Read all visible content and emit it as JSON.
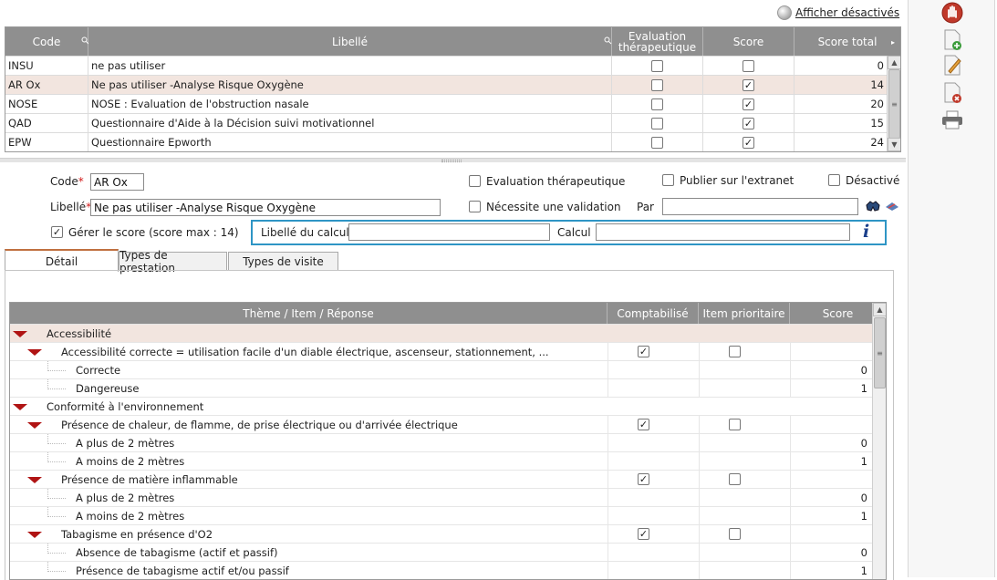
{
  "top": {
    "show_disabled_label": "Afficher désactivés"
  },
  "grid1": {
    "columns": [
      "Code",
      "Libellé",
      "Evaluation thérapeutique",
      "Score",
      "Score total"
    ],
    "rows": [
      {
        "code": "INSU",
        "libelle": "ne pas utiliser",
        "eval": false,
        "score": false,
        "total": "0",
        "selected": false
      },
      {
        "code": "AR Ox",
        "libelle": "Ne pas utiliser -Analyse Risque Oxygène",
        "eval": false,
        "score": true,
        "total": "14",
        "selected": true
      },
      {
        "code": "NOSE",
        "libelle": "NOSE : Evaluation de l'obstruction nasale",
        "eval": false,
        "score": true,
        "total": "20",
        "selected": false
      },
      {
        "code": "QAD",
        "libelle": "Questionnaire d'Aide à la Décision suivi motivationnel",
        "eval": false,
        "score": true,
        "total": "15",
        "selected": false
      },
      {
        "code": "EPW",
        "libelle": "Questionnaire Epworth",
        "eval": false,
        "score": true,
        "total": "24",
        "selected": false
      }
    ]
  },
  "form": {
    "code_label": "Code",
    "code_value": "AR Ox",
    "libelle_label": "Libellé",
    "libelle_value": "Ne pas utiliser -Analyse Risque Oxygène",
    "eval_label": "Evaluation thérapeutique",
    "eval_checked": false,
    "publish_label": "Publier sur l'extranet",
    "publish_checked": false,
    "disabled_label": "Désactivé",
    "disabled_checked": false,
    "validation_label": "Nécessite une validation",
    "validation_checked": false,
    "par_label": "Par",
    "par_value": "",
    "score_label": "Gérer le score (score max : 14)",
    "score_checked": true,
    "calc_label_label": "Libellé du calcul",
    "calc_label_value": "",
    "calc_label": "Calcul",
    "calc_value": ""
  },
  "tabs": [
    "Détail",
    "Types de prestation",
    "Types de visite"
  ],
  "grid2": {
    "columns": [
      "Thème / Item / Réponse",
      "Comptabilisé",
      "Item prioritaire",
      "Score"
    ],
    "rows": [
      {
        "level": 0,
        "label": "Accessibilité",
        "expand": true,
        "comp": null,
        "prio": null,
        "score": "",
        "selected": true
      },
      {
        "level": 1,
        "label": "Accessibilité correcte = utilisation facile d'un diable électrique, ascenseur, stationnement, ...",
        "expand": true,
        "comp": true,
        "prio": false,
        "score": ""
      },
      {
        "level": 2,
        "label": "Correcte",
        "expand": false,
        "comp": null,
        "prio": null,
        "score": "0"
      },
      {
        "level": 2,
        "label": "Dangereuse",
        "expand": false,
        "comp": null,
        "prio": null,
        "score": "1"
      },
      {
        "level": 0,
        "label": "Conformité à l'environnement",
        "expand": true,
        "comp": null,
        "prio": null,
        "score": ""
      },
      {
        "level": 1,
        "label": "Présence de chaleur, de flamme, de prise électrique ou d'arrivée électrique",
        "expand": true,
        "comp": true,
        "prio": false,
        "score": ""
      },
      {
        "level": 2,
        "label": "A plus de 2 mètres",
        "expand": false,
        "comp": null,
        "prio": null,
        "score": "0"
      },
      {
        "level": 2,
        "label": "A moins de 2 mètres",
        "expand": false,
        "comp": null,
        "prio": null,
        "score": "1"
      },
      {
        "level": 1,
        "label": "Présence de matière inflammable",
        "expand": true,
        "comp": true,
        "prio": false,
        "score": ""
      },
      {
        "level": 2,
        "label": "A plus de 2 mètres",
        "expand": false,
        "comp": null,
        "prio": null,
        "score": "0"
      },
      {
        "level": 2,
        "label": "A moins de 2 mètres",
        "expand": false,
        "comp": null,
        "prio": null,
        "score": "1"
      },
      {
        "level": 1,
        "label": "Tabagisme en présence d'O2",
        "expand": true,
        "comp": true,
        "prio": false,
        "score": ""
      },
      {
        "level": 2,
        "label": "Absence de tabagisme (actif et passif)",
        "expand": false,
        "comp": null,
        "prio": null,
        "score": "0"
      },
      {
        "level": 2,
        "label": "Présence de tabagisme actif et/ou passif",
        "expand": false,
        "comp": null,
        "prio": null,
        "score": "1"
      }
    ]
  },
  "toolbar": {
    "icons": [
      "stop-icon",
      "add-document-icon",
      "edit-document-icon",
      "delete-document-icon",
      "print-icon"
    ]
  },
  "colors": {
    "header_bg": "#8f8f8f",
    "selected_row": "#f2e5df",
    "accent_blue": "#2e95c5",
    "tree_red": "#b01414"
  }
}
